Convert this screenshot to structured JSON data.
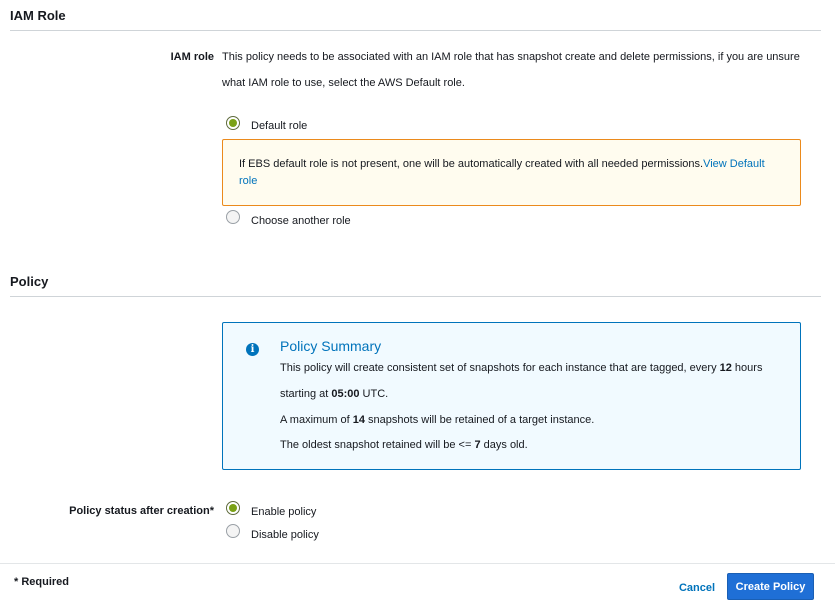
{
  "iam_section": {
    "title": "IAM Role",
    "field_label": "IAM role",
    "description_line1": "This policy needs to be associated with an IAM role that has snapshot create and delete permissions, if you are unsure",
    "description_line2": "what IAM role to use, select the AWS Default role.",
    "options": {
      "default_role": {
        "label": "Default role",
        "checked": true
      },
      "another_role": {
        "label": "Choose another role",
        "checked": false
      }
    },
    "warning": {
      "text": "If EBS default role is not present, one will be automatically created with all needed permissions.",
      "link_part1": "View Default",
      "link_part2": "role"
    }
  },
  "policy_section": {
    "title": "Policy",
    "summary": {
      "title": "Policy Summary",
      "line1_prefix": "This policy will create consistent set of snapshots for each instance that are tagged, every ",
      "interval_value": "12",
      "line1_suffix": " hours",
      "line2_prefix": "starting at ",
      "start_time": "05:00",
      "line2_suffix": " UTC.",
      "line3_prefix": "A maximum of ",
      "max_snapshots": "14",
      "line3_suffix": " snapshots will be retained of a target instance.",
      "line4_prefix": "The oldest snapshot retained will be <= ",
      "max_age_days": "7",
      "line4_suffix": " days old."
    },
    "status_label": "Policy status after creation*",
    "status_options": {
      "enable": {
        "label": "Enable policy",
        "checked": true
      },
      "disable": {
        "label": "Disable policy",
        "checked": false
      }
    }
  },
  "footer": {
    "required_note": "* Required",
    "cancel_label": "Cancel",
    "create_label": "Create Policy"
  },
  "colors": {
    "accent": "#0073bb",
    "primary_button": "#1f6fd6",
    "warning_border": "#eb8a1c",
    "warning_bg": "#fffcef",
    "info_bg": "#f1faff",
    "radio_selected": "#7aa116"
  }
}
